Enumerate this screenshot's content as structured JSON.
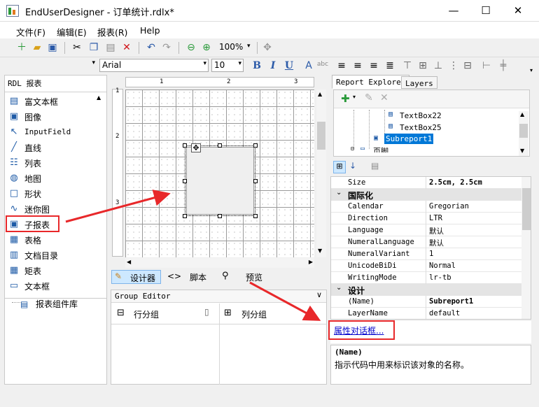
{
  "window": {
    "title": "EndUserDesigner - 订单统计.rdlx*",
    "minimize": "—",
    "maximize": "☐",
    "close": "✕"
  },
  "menu": [
    "文件(F)",
    "编辑(E)",
    "报表(R)",
    "Help"
  ],
  "toolbar": {
    "zoom": "100%",
    "zoom_arrow": "▾"
  },
  "format_toolbar": {
    "font": "Arial",
    "size": "10",
    "bold": "B",
    "italic": "I",
    "underline": "U",
    "arrow": "▾"
  },
  "toolbox": {
    "header": "RDL 报表",
    "items": [
      {
        "label": "富文本框",
        "icon": "richtext-icon"
      },
      {
        "label": "图像",
        "icon": "image-icon"
      },
      {
        "label": "InputField",
        "icon": "inputfield-icon"
      },
      {
        "label": "直线",
        "icon": "line-icon"
      },
      {
        "label": "列表",
        "icon": "list-icon"
      },
      {
        "label": "地图",
        "icon": "map-icon"
      },
      {
        "label": "形状",
        "icon": "shape-icon"
      },
      {
        "label": "迷你图",
        "icon": "sparkline-icon"
      },
      {
        "label": "子报表",
        "icon": "subreport-icon"
      },
      {
        "label": "表格",
        "icon": "table-icon"
      },
      {
        "label": "文档目录",
        "icon": "toc-icon"
      },
      {
        "label": "矩表",
        "icon": "matrix-icon"
      },
      {
        "label": "文本框",
        "icon": "textbox-icon"
      }
    ],
    "library": "报表组件库"
  },
  "ruler": {
    "h": [
      "1",
      "2",
      "3"
    ],
    "v": [
      "1",
      "2",
      "3"
    ]
  },
  "view_tabs": {
    "designer": "设计器",
    "script": "脚本",
    "preview": "预览"
  },
  "group_editor": {
    "title": "Group Editor",
    "row_groups": "行分组",
    "col_groups": "列分组"
  },
  "explorer": {
    "tabs": [
      "Report Explorer",
      "Layers"
    ],
    "tree": [
      "TextBox22",
      "TextBox25",
      "Subreport1",
      "页脚"
    ]
  },
  "properties": {
    "rows": [
      {
        "kind": "prop",
        "key": "Size",
        "value": "2.5cm, 2.5cm",
        "bold": true
      },
      {
        "kind": "cat",
        "key": "国际化"
      },
      {
        "kind": "prop",
        "key": "Calendar",
        "value": "Gregorian"
      },
      {
        "kind": "prop",
        "key": "Direction",
        "value": "LTR"
      },
      {
        "kind": "prop",
        "key": "Language",
        "value": "默认"
      },
      {
        "kind": "prop",
        "key": "NumeralLanguage",
        "value": "默认"
      },
      {
        "kind": "prop",
        "key": "NumeralVariant",
        "value": "1"
      },
      {
        "kind": "prop",
        "key": "UnicodeBiDi",
        "value": "Normal"
      },
      {
        "kind": "prop",
        "key": "WritingMode",
        "value": "lr-tb"
      },
      {
        "kind": "cat",
        "key": "设计"
      },
      {
        "kind": "prop",
        "key": "(Name)",
        "value": "Subreport1",
        "bold": true
      },
      {
        "kind": "prop",
        "key": "LayerName",
        "value": "default"
      }
    ],
    "dialog_link": "属性对话框...",
    "desc_title": "(Name)",
    "desc_text": "指示代码中用来标识该对象的名称。"
  },
  "colors": {
    "highlight": "#e8282a",
    "selection": "#0078d7",
    "link": "#0000cc"
  }
}
